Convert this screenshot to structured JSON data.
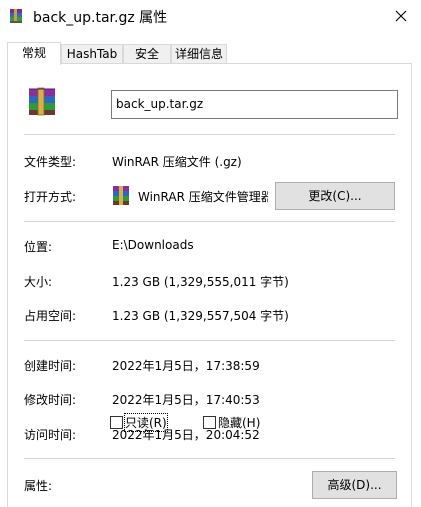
{
  "window": {
    "title": "back_up.tar.gz 属性",
    "close_icon": "close-icon"
  },
  "tabs": [
    {
      "label": "常规",
      "active": true
    },
    {
      "label": "HashTab",
      "active": false
    },
    {
      "label": "安全",
      "active": false
    },
    {
      "label": "详细信息",
      "active": false
    }
  ],
  "general": {
    "file_name": "back_up.tar.gz",
    "type_label": "文件类型:",
    "type_value": "WinRAR 压缩文件 (.gz)",
    "opens_with_label": "打开方式:",
    "opens_with_value": "WinRAR 压缩文件管理器",
    "change_button": "更改(C)...",
    "location_label": "位置:",
    "location_value": "E:\\Downloads",
    "size_label": "大小:",
    "size_value": "1.23 GB (1,329,555,011 字节)",
    "size_on_disk_label": "占用空间:",
    "size_on_disk_value": "1.23 GB (1,329,557,504 字节)",
    "created_label": "创建时间:",
    "created_value": "2022年1月5日，17:38:59",
    "modified_label": "修改时间:",
    "modified_value": "2022年1月5日，17:40:53",
    "accessed_label": "访问时间:",
    "accessed_value": "2022年1月5日，20:04:52",
    "attributes_label": "属性:",
    "readonly_label": "只读(R)",
    "readonly_checked": false,
    "hidden_label": "隐藏(H)",
    "hidden_checked": false,
    "advanced_button": "高级(D)..."
  }
}
